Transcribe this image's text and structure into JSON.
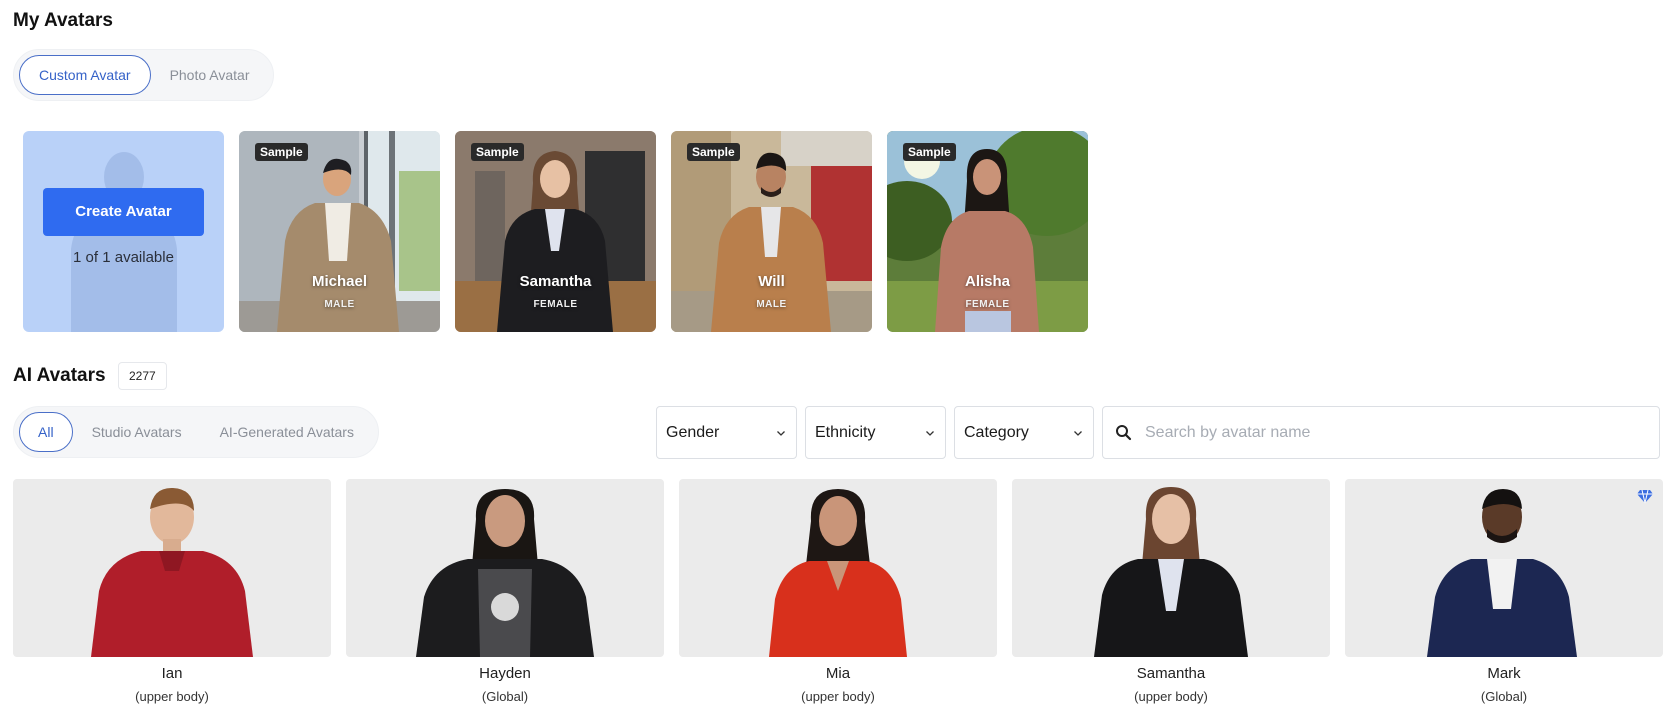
{
  "my_avatars": {
    "title": "My Avatars",
    "tabs": [
      {
        "label": "Custom Avatar",
        "active": true
      },
      {
        "label": "Photo Avatar",
        "active": false
      }
    ],
    "create": {
      "button_label": "Create Avatar",
      "availability": "1 of 1 available"
    },
    "samples": [
      {
        "badge": "Sample",
        "name": "Michael",
        "gender": "MALE"
      },
      {
        "badge": "Sample",
        "name": "Samantha",
        "gender": "FEMALE"
      },
      {
        "badge": "Sample",
        "name": "Will",
        "gender": "MALE"
      },
      {
        "badge": "Sample",
        "name": "Alisha",
        "gender": "FEMALE"
      }
    ]
  },
  "ai_avatars": {
    "title": "AI Avatars",
    "count": "2277",
    "tabs": [
      {
        "label": "All",
        "active": true
      },
      {
        "label": "Studio Avatars",
        "active": false
      },
      {
        "label": "AI-Generated Avatars",
        "active": false
      }
    ],
    "filters": {
      "gender": "Gender",
      "ethnicity": "Ethnicity",
      "category": "Category"
    },
    "search": {
      "placeholder": "Search by avatar name",
      "value": ""
    },
    "items": [
      {
        "name": "Ian",
        "sub": "(upper body)",
        "premium": false
      },
      {
        "name": "Hayden",
        "sub": "(Global)",
        "premium": false
      },
      {
        "name": "Mia",
        "sub": "(upper body)",
        "premium": false
      },
      {
        "name": "Samantha",
        "sub": "(upper body)",
        "premium": false
      },
      {
        "name": "Mark",
        "sub": "(Global)",
        "premium": true
      }
    ]
  },
  "colors": {
    "accent": "#2f6bf0",
    "tab_active_border": "#4a6fc8",
    "create_card_bg": "#b9d1f8",
    "thumb_bg": "#ebebeb"
  },
  "icons": {
    "dropdown": "chevron-down-icon",
    "search": "search-icon",
    "premium": "diamond-icon"
  }
}
